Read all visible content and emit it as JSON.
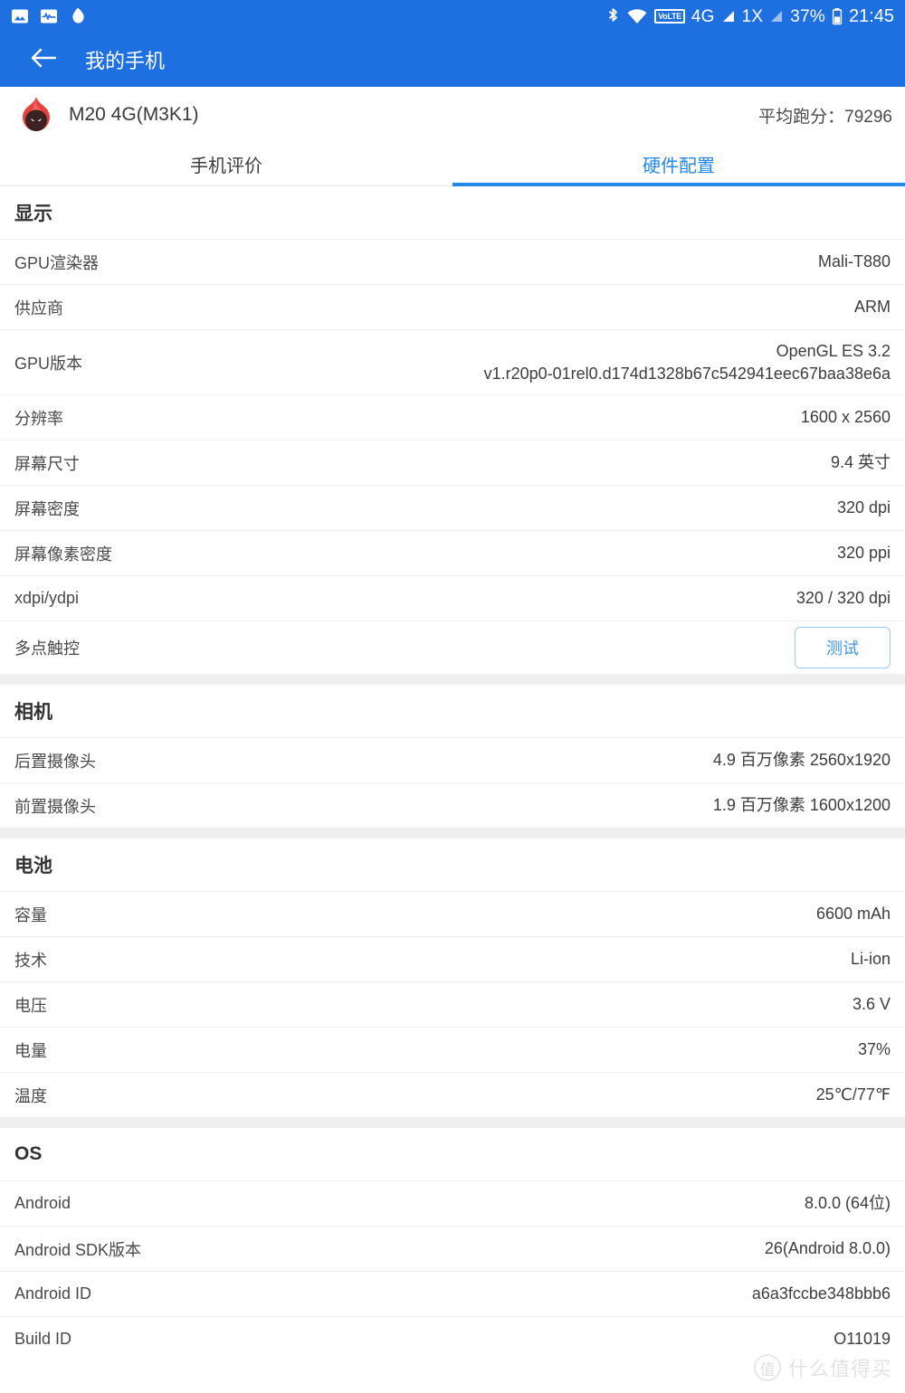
{
  "status_bar": {
    "left_icons": [
      "gallery-icon",
      "monitor-chart-icon",
      "antutu-drop-icon"
    ],
    "bluetooth_icon": "bluetooth-icon",
    "wifi_icon": "wifi-icon",
    "volte_label": "VoLTE",
    "network_1": "4G",
    "network_2": "1X",
    "battery_percent": "37%",
    "time": "21:45"
  },
  "app_bar": {
    "back_icon": "back-arrow-icon",
    "title": "我的手机"
  },
  "device": {
    "logo": "antutu-flame-logo",
    "name": "M20 4G(M3K1)",
    "average_score_label": "平均跑分：79296"
  },
  "tabs": [
    {
      "label": "手机评价",
      "active": false
    },
    {
      "label": "硬件配置",
      "active": true
    }
  ],
  "sections": {
    "display": {
      "title": "显示",
      "rows": [
        {
          "key": "GPU渲染器",
          "value": "Mali-T880"
        },
        {
          "key": "供应商",
          "value": "ARM"
        },
        {
          "key": "GPU版本",
          "value": "OpenGL ES 3.2\nv1.r20p0-01rel0.d174d1328b67c542941eec67baa38e6a"
        },
        {
          "key": "分辨率",
          "value": "1600 x 2560"
        },
        {
          "key": "屏幕尺寸",
          "value": "9.4 英寸"
        },
        {
          "key": "屏幕密度",
          "value": "320 dpi"
        },
        {
          "key": "屏幕像素密度",
          "value": "320 ppi"
        },
        {
          "key": "xdpi/ydpi",
          "value": "320 / 320 dpi"
        },
        {
          "key": "多点触控",
          "value": "测试",
          "is_button": true
        }
      ]
    },
    "camera": {
      "title": "相机",
      "rows": [
        {
          "key": "后置摄像头",
          "value": "4.9 百万像素 2560x1920"
        },
        {
          "key": "前置摄像头",
          "value": "1.9 百万像素 1600x1200"
        }
      ]
    },
    "battery": {
      "title": "电池",
      "rows": [
        {
          "key": "容量",
          "value": "6600 mAh"
        },
        {
          "key": "技术",
          "value": "Li-ion"
        },
        {
          "key": "电压",
          "value": "3.6 V"
        },
        {
          "key": "电量",
          "value": "37%"
        },
        {
          "key": "温度",
          "value": "25℃/77℉"
        }
      ]
    },
    "os": {
      "title": "OS",
      "rows": [
        {
          "key": "Android",
          "value": "8.0.0 (64位)"
        },
        {
          "key": "Android SDK版本",
          "value": "26(Android 8.0.0)"
        },
        {
          "key": "Android ID",
          "value": "a6a3fccbe348bbb6"
        },
        {
          "key": "Build ID",
          "value": "O11019"
        }
      ]
    }
  },
  "watermark": {
    "mark": "值",
    "text": "什么值得买"
  },
  "colors": {
    "brand_blue": "#1e6fe0",
    "accent_blue": "#2488e8",
    "section_gap": "#efefef"
  }
}
